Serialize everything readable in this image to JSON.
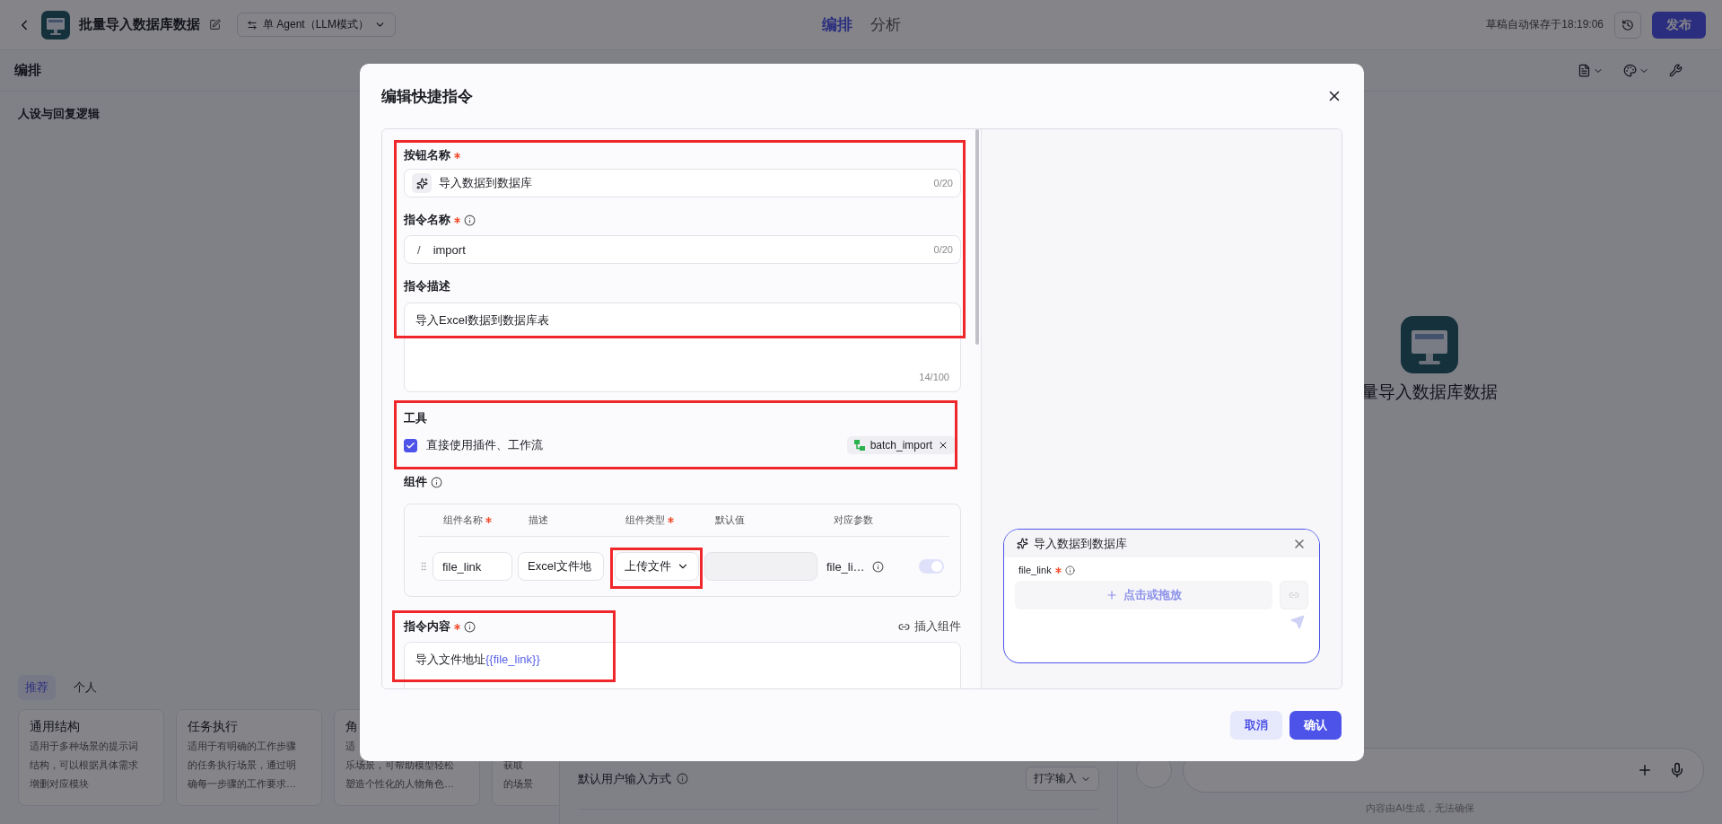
{
  "header": {
    "app_title": "批量导入数据库数据",
    "mode": "单 Agent（LLM模式）",
    "tabs": [
      {
        "label": "编排",
        "selected": true
      },
      {
        "label": "分析",
        "selected": false
      }
    ],
    "autosave": "草稿自动保存于18:19:06",
    "publish": "发布"
  },
  "subheader": {
    "title": "编排"
  },
  "left_panel": {
    "heading": "人设与回复逻辑",
    "template_tabs": [
      {
        "label": "推荐",
        "selected": true
      },
      {
        "label": "个人",
        "selected": false
      }
    ],
    "templates": [
      {
        "title": "通用结构",
        "lines": [
          "适用于多种场景的提示词",
          "结构，可以根据具体需求",
          "增删对应模块"
        ]
      },
      {
        "title": "任务执行",
        "lines": [
          "适用于有明确的工作步骤",
          "的任务执行场景，通过明",
          "确每一步骤的工作要求…"
        ]
      },
      {
        "title": "角",
        "lines": [
          "适",
          "乐场景，可帮助模型轻松",
          "塑造个性化的人物角色…"
        ]
      },
      {
        "lines": [
          "获取",
          "的场景"
        ]
      }
    ]
  },
  "middle_panel": {
    "input_mode_label": "默认用户输入方式",
    "input_mode_value": "打字输入"
  },
  "preview_panel": {
    "bot_name": "量导入数据库数据",
    "disclaimer": "内容由AI生成，无法确保"
  },
  "dialog": {
    "title": "编辑快捷指令",
    "button_name": {
      "label": "按钮名称",
      "required": true,
      "value": "导入数据到数据库",
      "counter": "0/20"
    },
    "command_name": {
      "label": "指令名称",
      "required": true,
      "prefix": "/",
      "value": "import",
      "counter": "0/20"
    },
    "description": {
      "label": "指令描述",
      "value": "导入Excel数据到数据库表",
      "counter": "14/100"
    },
    "tools": {
      "label": "工具",
      "checkbox_label": "直接使用插件、工作流",
      "checked": true,
      "tool_tag": "batch_import"
    },
    "components": {
      "label": "组件",
      "columns": [
        {
          "label": "组件名称",
          "required": true
        },
        {
          "label": "描述",
          "required": false
        },
        {
          "label": "组件类型",
          "required": true
        },
        {
          "label": "默认值",
          "required": false
        },
        {
          "label": "对应参数",
          "required": false
        }
      ],
      "rows": [
        {
          "name": "file_link",
          "description": "Excel文件地",
          "type": "上传文件",
          "param": "file_li…",
          "on": true
        }
      ]
    },
    "content": {
      "label": "指令内容",
      "required": true,
      "insert": "插入组件",
      "parts": [
        {
          "kind": "plain",
          "text": "导入文件地址"
        },
        {
          "kind": "variable",
          "text": "{{file_link}}"
        }
      ]
    },
    "preview": {
      "title": "导入数据到数据库",
      "field_label": "file_link",
      "required": true,
      "upload_text": "点击或拖放"
    },
    "buttons": [
      {
        "kind": "secondary",
        "label": "取消"
      },
      {
        "kind": "primary",
        "label": "确认"
      }
    ]
  }
}
